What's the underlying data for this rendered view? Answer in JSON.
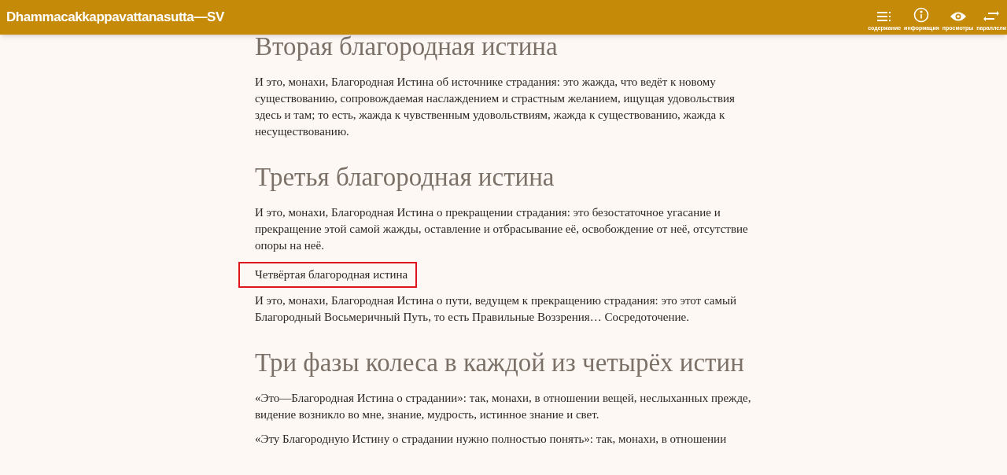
{
  "header": {
    "title": "Dhammacakkappavattanasutta—SV",
    "actions": [
      {
        "kind": "contents",
        "label": "содержание"
      },
      {
        "kind": "info",
        "label": "информация"
      },
      {
        "kind": "views",
        "label": "просмотры"
      },
      {
        "kind": "parallels",
        "label": "параллели"
      }
    ]
  },
  "content": [
    {
      "kind": "heading",
      "text": "Вторая благородная истина"
    },
    {
      "kind": "paragraph",
      "text": "И это, монахи, Благородная Истина об источнике страдания: это жажда, что ведёт к новому существованию, сопровождаемая наслаждением и страстным желанием, ищущая удовольствия здесь и там; то есть, жажда к чувственным удовольствиям, жажда к существованию, жажда к несуществованию.",
      "highlighted": false
    },
    {
      "kind": "heading",
      "text": "Третья благородная истина"
    },
    {
      "kind": "paragraph",
      "text": "И это, монахи, Благородная Истина о прекращении страдания: это безостаточное угасание и прекращение этой самой жажды, оставление и отбрасывание её, освобождение от неё, отсутствие опоры на неё.",
      "highlighted": false
    },
    {
      "kind": "paragraph",
      "text": "Четвёртая благородная истина",
      "highlighted": true
    },
    {
      "kind": "paragraph",
      "text": "И это, монахи, Благородная Истина о пути, ведущем к прекращению страдания: это этот самый Благородный Восьмеричный Путь, то есть Правильные Воззрения… Сосредоточение.",
      "highlighted": false
    },
    {
      "kind": "heading",
      "text": "Три фазы колеса в каждой из четырёх истин"
    },
    {
      "kind": "paragraph",
      "text": "«Это—Благородная Истина о страдании»: так, монахи, в отношении вещей, неслыханных прежде, видение возникло во мне, знание, мудрость, истинное знание и свет.",
      "highlighted": false
    },
    {
      "kind": "paragraph",
      "text": "«Эту Благородную Истину о страдании нужно полностью понять»: так, монахи, в отношении",
      "highlighted": false
    }
  ]
}
